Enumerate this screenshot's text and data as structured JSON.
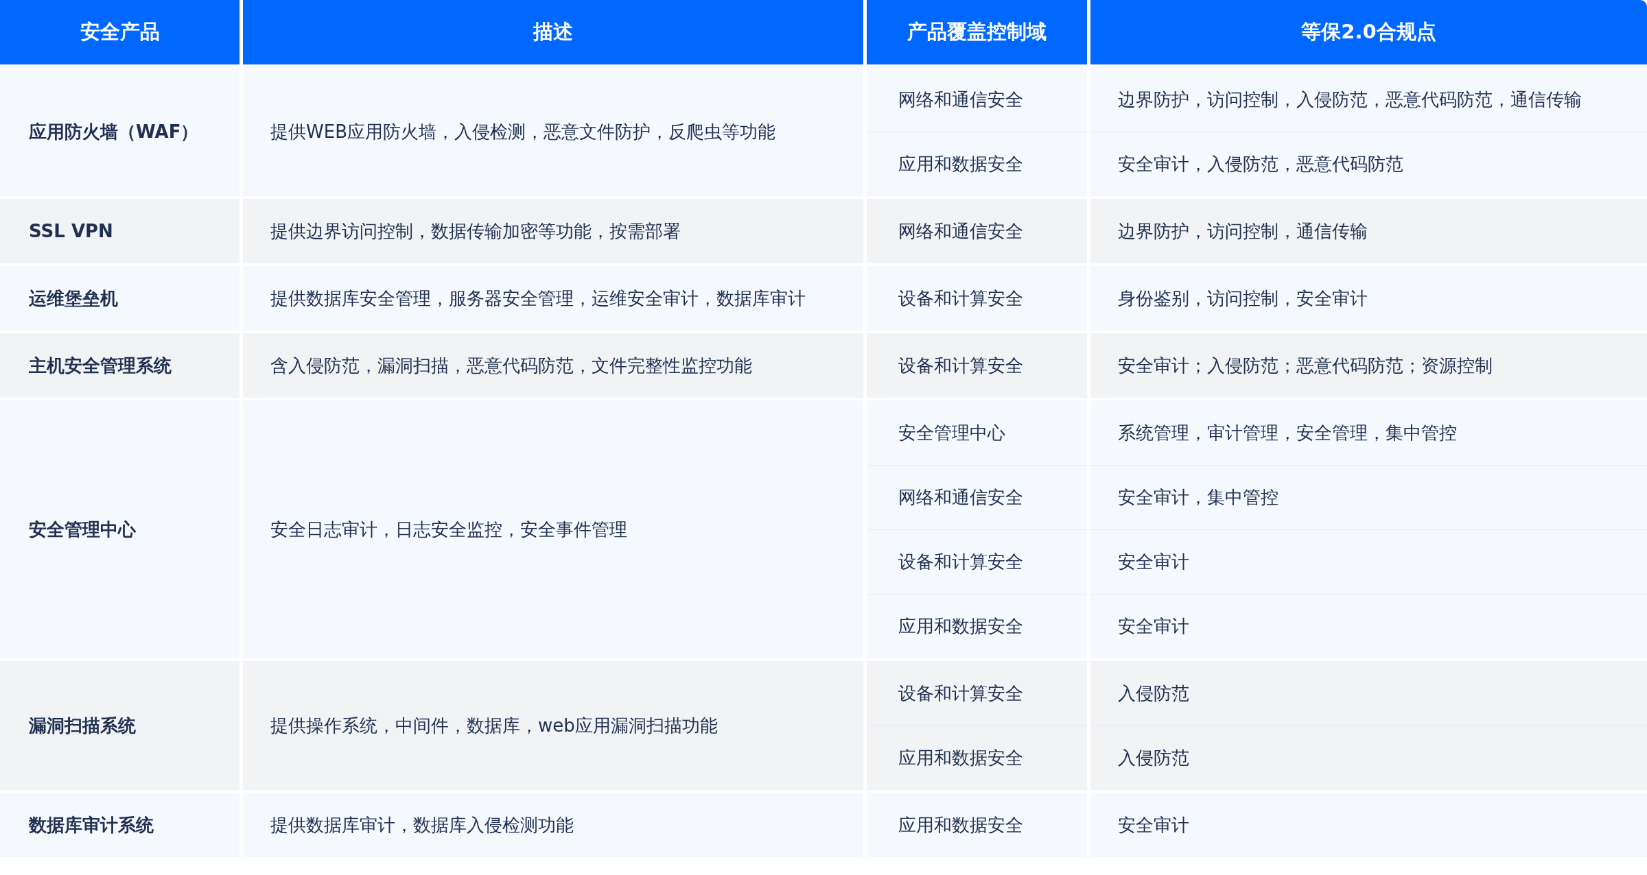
{
  "table": {
    "columns": [
      "安全产品",
      "描述",
      "产品覆盖控制域",
      "等保2.0合规点"
    ],
    "rows": [
      {
        "product": "应用防火墙（WAF）",
        "description": "提供WEB应用防火墙，入侵检测，恶意文件防护，反爬虫等功能",
        "coverage": [
          {
            "domain": "网络和通信安全",
            "points": "边界防护，访问控制，入侵防范，恶意代码防范，通信传输"
          },
          {
            "domain": "应用和数据安全",
            "points": "安全审计，入侵防范，恶意代码防范"
          }
        ]
      },
      {
        "product": "SSL VPN",
        "description": "提供边界访问控制，数据传输加密等功能，按需部署",
        "coverage": [
          {
            "domain": "网络和通信安全",
            "points": "边界防护，访问控制，通信传输"
          }
        ]
      },
      {
        "product": "运维堡垒机",
        "description": "提供数据库安全管理，服务器安全管理，运维安全审计，数据库审计",
        "coverage": [
          {
            "domain": "设备和计算安全",
            "points": "身份鉴别，访问控制，安全审计"
          }
        ]
      },
      {
        "product": "主机安全管理系统",
        "description": "含入侵防范，漏洞扫描，恶意代码防范，文件完整性监控功能",
        "coverage": [
          {
            "domain": "设备和计算安全",
            "points": "安全审计；入侵防范；恶意代码防范；资源控制"
          }
        ]
      },
      {
        "product": "安全管理中心",
        "description": "安全日志审计，日志安全监控，安全事件管理",
        "coverage": [
          {
            "domain": "安全管理中心",
            "points": "系统管理，审计管理，安全管理，集中管控"
          },
          {
            "domain": "网络和通信安全",
            "points": "安全审计，集中管控"
          },
          {
            "domain": "设备和计算安全",
            "points": "安全审计"
          },
          {
            "domain": "应用和数据安全",
            "points": "安全审计"
          }
        ]
      },
      {
        "product": "漏洞扫描系统",
        "description": "提供操作系统，中间件，数据库，web应用漏洞扫描功能",
        "coverage": [
          {
            "domain": "设备和计算安全",
            "points": "入侵防范"
          },
          {
            "domain": "应用和数据安全",
            "points": "入侵防范"
          }
        ]
      },
      {
        "product": "数据库审计系统",
        "description": "提供数据库审计，数据库入侵检测功能",
        "coverage": [
          {
            "domain": "应用和数据安全",
            "points": "安全审计"
          }
        ]
      }
    ]
  }
}
